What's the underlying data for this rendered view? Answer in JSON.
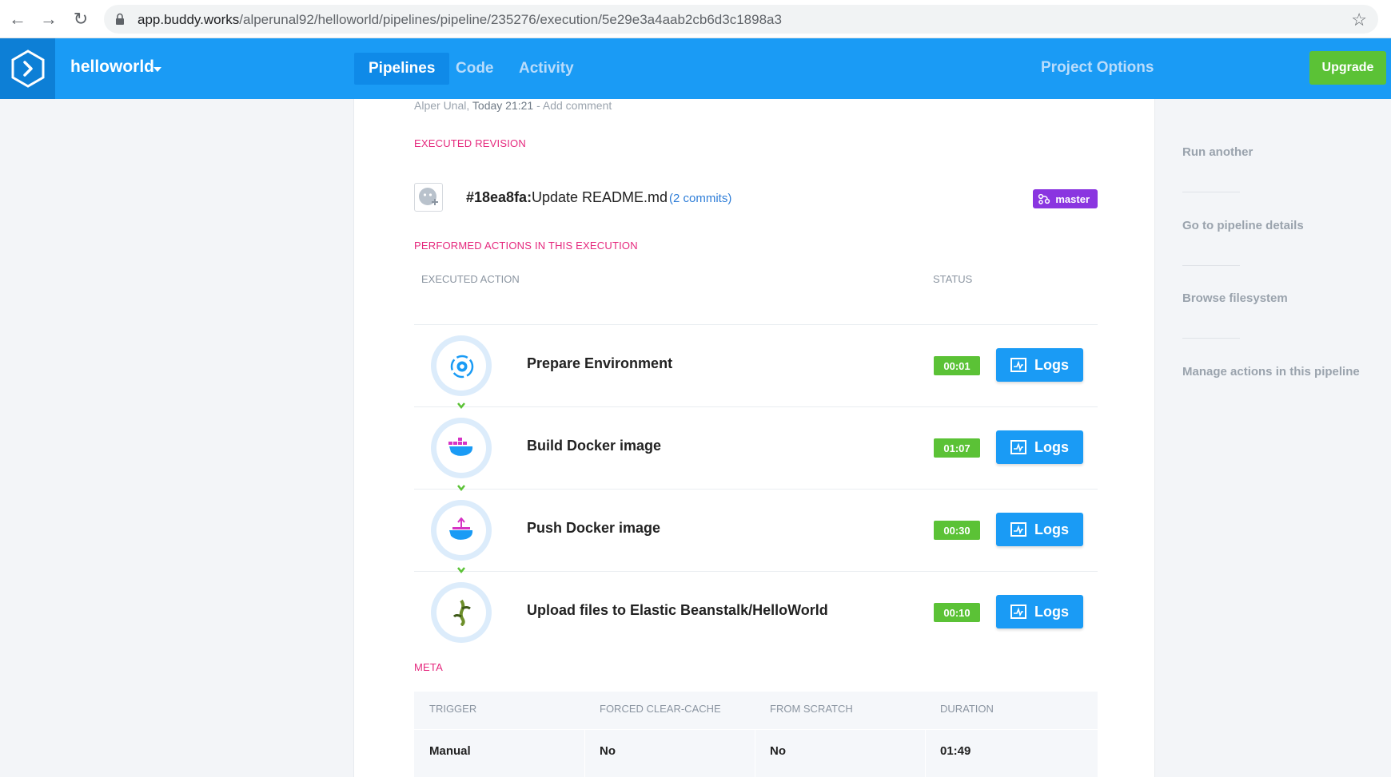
{
  "browser": {
    "url_host": "app.buddy.works",
    "url_path": "/alperunal92/helloworld/pipelines/pipeline/235276/execution/5e29e3a4aab2cb6d3c1898a3"
  },
  "header": {
    "project_name": "helloworld",
    "tabs": [
      {
        "label": "Pipelines",
        "active": true
      },
      {
        "label": "Code",
        "active": false
      },
      {
        "label": "Activity",
        "active": false
      }
    ],
    "project_options": "Project Options",
    "upgrade_label": "Upgrade"
  },
  "execution": {
    "author": "Alper Unal",
    "time": "Today 21:21",
    "add_comment": "- Add comment",
    "revision_title": "EXECUTED REVISION",
    "revision_hash": "#18ea8fa:",
    "revision_message": "Update README.md",
    "revision_commits": "(2 commits)",
    "branch": "master",
    "actions_title": "PERFORMED ACTIONS IN THIS EXECUTION",
    "col_action": "EXECUTED ACTION",
    "col_status": "STATUS",
    "logs_label": "Logs",
    "actions": [
      {
        "name": "Prepare Environment",
        "duration": "00:01",
        "icon": "environment-gear-icon"
      },
      {
        "name": "Build Docker image",
        "duration": "01:07",
        "icon": "docker-icon"
      },
      {
        "name": "Push Docker image",
        "duration": "00:30",
        "icon": "docker-push-icon"
      },
      {
        "name": "Upload files to Elastic Beanstalk/HelloWorld",
        "duration": "00:10",
        "icon": "elastic-beanstalk-icon"
      }
    ],
    "meta_title": "META",
    "meta": {
      "headers": [
        "TRIGGER",
        "FORCED CLEAR-CACHE",
        "FROM SCRATCH",
        "DURATION"
      ],
      "values": [
        "Manual",
        "No",
        "No",
        "01:49"
      ]
    }
  },
  "sidebar": {
    "links": [
      "Run another",
      "Go to pipeline details",
      "Browse filesystem",
      "Manage actions in this pipeline"
    ]
  },
  "colors": {
    "brand_blue": "#1a9bf5",
    "success_green": "#5bc236",
    "section_pink": "#e5287d",
    "branch_purple": "#8a35e0"
  }
}
